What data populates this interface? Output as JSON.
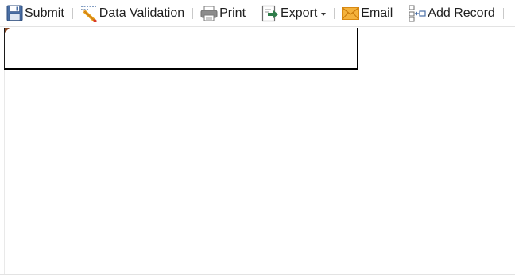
{
  "toolbar": {
    "submit_label": "Submit",
    "data_validation_label": "Data Validation",
    "print_label": "Print",
    "export_label": "Export",
    "email_label": "Email",
    "add_record_label": "Add Record"
  },
  "icons": {
    "submit": "save-icon",
    "data_validation": "pencil-icon",
    "print": "printer-icon",
    "export": "export-icon",
    "email": "envelope-icon",
    "add_record": "add-record-icon"
  },
  "colors": {
    "save_icon_blue": "#4a6fa5",
    "email_icon_orange": "#f0a020",
    "cell_corner": "#8a4a26"
  }
}
